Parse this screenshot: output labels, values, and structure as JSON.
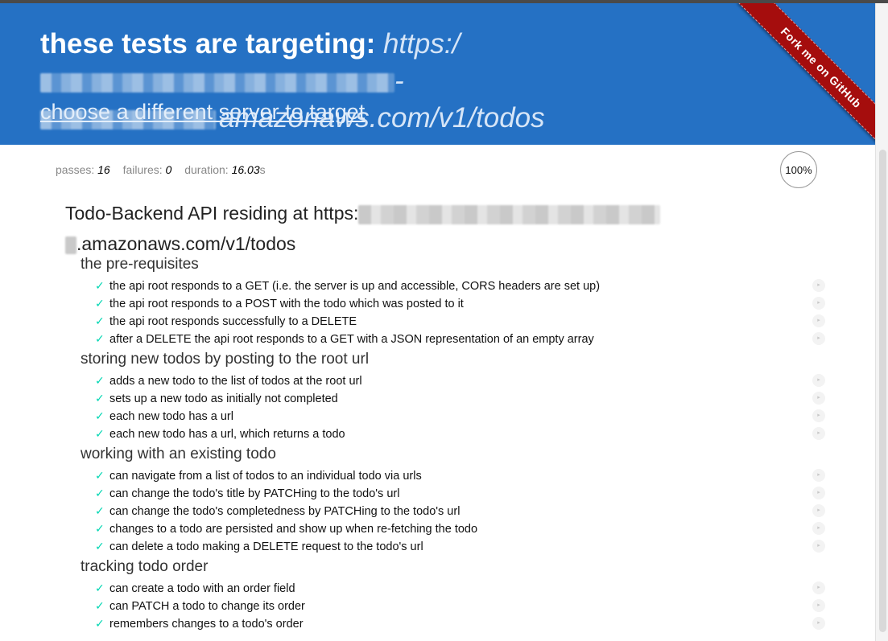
{
  "header": {
    "label": "these tests are targeting:",
    "url_prefix": "https:/",
    "url_dash": "-",
    "url_suffix": "amazonaws.com/v1/todos",
    "change_link": "choose a different server to target",
    "fork_ribbon": "Fork me on GitHub",
    "background_color": "#2571c4",
    "ribbon_color": "#a50d0d"
  },
  "stats": {
    "passes_label": "passes:",
    "passes": "16",
    "failures_label": "failures:",
    "failures": "0",
    "duration_label": "duration:",
    "duration": "16.03",
    "duration_unit": "s",
    "progress": "100%"
  },
  "suite": {
    "title_prefix": "Todo-Backend API residing at https:",
    "title_suffix": ".amazonaws.com/v1/todos"
  },
  "sections": [
    {
      "title": "the pre-requisites",
      "tests": [
        "the api root responds to a GET (i.e. the server is up and accessible, CORS headers are set up)",
        "the api root responds to a POST with the todo which was posted to it",
        "the api root responds successfully to a DELETE",
        "after a DELETE the api root responds to a GET with a JSON representation of an empty array"
      ]
    },
    {
      "title": "storing new todos by posting to the root url",
      "tests": [
        "adds a new todo to the list of todos at the root url",
        "sets up a new todo as initially not completed",
        "each new todo has a url",
        "each new todo has a url, which returns a todo"
      ]
    },
    {
      "title": "working with an existing todo",
      "tests": [
        "can navigate from a list of todos to an individual todo via urls",
        "can change the todo's title by PATCHing to the todo's url",
        "can change the todo's completedness by PATCHing to the todo's url",
        "changes to a todo are persisted and show up when re-fetching the todo",
        "can delete a todo making a DELETE request to the todo's url"
      ]
    },
    {
      "title": "tracking todo order",
      "tests": [
        "can create a todo with an order field",
        "can PATCH a todo to change its order",
        "remembers changes to a todo's order"
      ]
    }
  ],
  "icons": {
    "pass": "checkmark-icon",
    "pass_glyph": "✓",
    "replay": "replay-icon",
    "replay_glyph": "▸",
    "pass_color": "#00d6b2"
  }
}
